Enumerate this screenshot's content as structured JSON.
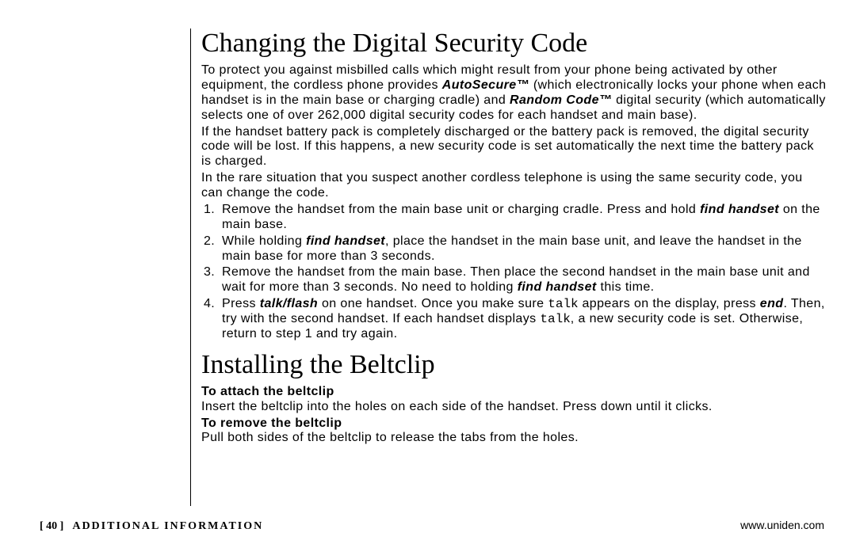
{
  "section1": {
    "heading": "Changing the Digital Security Code",
    "p1a": "To protect you against misbilled calls which might result from your phone being activated by other equipment, the cordless phone provides ",
    "autosecure": "AutoSecure™",
    "p1b": " (which electronically locks your phone when each handset is in the main base or charging cradle) and ",
    "randomcode": "Random Code™",
    "p1c": " digital security (which automatically selects one of over 262,000 digital security codes for each handset and main base).",
    "p2": "If the handset battery pack is completely discharged or the battery pack is removed, the digital security code will be lost. If this happens, a new security code is set automatically the next time the battery pack is charged.",
    "p3": "In the rare situation that you suspect another cordless telephone is using the same security code, you can change the code.",
    "step1a": "Remove the handset from the main base unit or charging cradle. Press and hold ",
    "findhandset": "find handset",
    "step1b": " on the main base.",
    "step2a": "While holding ",
    "step2b": ", place the handset in the main base unit, and leave the handset in the main base for more than 3 seconds.",
    "step3a": "Remove the handset from the main base. Then place the second handset in the main base unit and wait for more than 3 seconds. No need to holding ",
    "step3b": " this time.",
    "step4a": "Press ",
    "talkflash": "talk/flash",
    "step4b": " on one handset. Once you make sure ",
    "talk": "talk",
    "step4c": " appears on the display, press ",
    "end": "end",
    "step4d": ". Then, try with the second handset. If each handset displays ",
    "step4e": ", a new security code is set. Otherwise, return to step 1 and try again."
  },
  "section2": {
    "heading": "Installing the Beltclip",
    "attach_head": "To attach the beltclip",
    "attach_body": "Insert the beltclip into the holes on each side of the handset. Press down until it clicks.",
    "remove_head": "To remove the beltclip",
    "remove_body": "Pull both sides of the beltclip to release the tabs from the holes."
  },
  "footer": {
    "page_no": "[ 40 ]",
    "section": "ADDITIONAL INFORMATION",
    "url": "www.uniden.com"
  }
}
